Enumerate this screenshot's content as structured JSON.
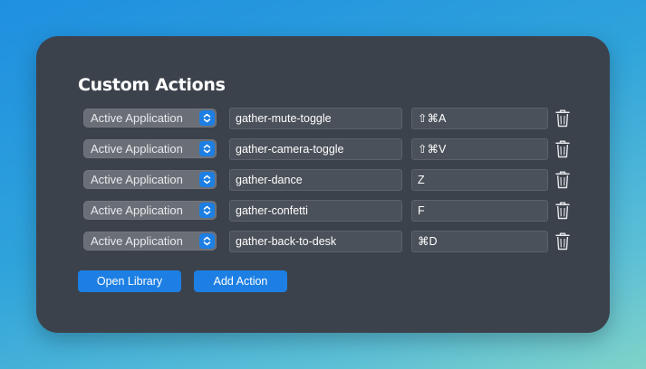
{
  "panel": {
    "title": "Custom Actions"
  },
  "rows": [
    {
      "target": "Active Application",
      "action": "gather-mute-toggle",
      "shortcut": "⇧⌘A"
    },
    {
      "target": "Active Application",
      "action": "gather-camera-toggle",
      "shortcut": "⇧⌘V"
    },
    {
      "target": "Active Application",
      "action": "gather-dance",
      "shortcut": "Z"
    },
    {
      "target": "Active Application",
      "action": "gather-confetti",
      "shortcut": "F"
    },
    {
      "target": "Active Application",
      "action": "gather-back-to-desk",
      "shortcut": "⌘D"
    }
  ],
  "buttons": {
    "open_library": "Open Library",
    "add_action": "Add Action"
  },
  "icons": {
    "select_chevron": "chevron-up-down-icon",
    "delete": "trash-icon"
  },
  "colors": {
    "accent": "#1d7fe3",
    "panel_bg": "#3c424c",
    "field_bg": "#4b515a"
  }
}
